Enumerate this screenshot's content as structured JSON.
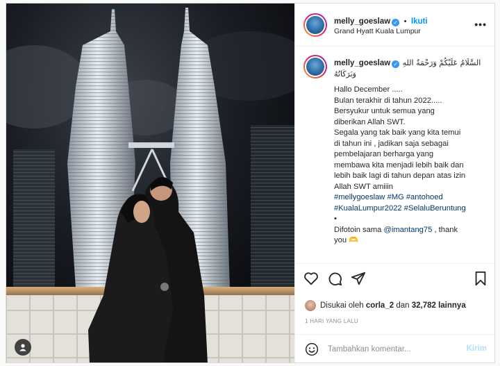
{
  "header": {
    "username": "melly_goeslaw",
    "follow_separator": "•",
    "follow_label": "Ikuti",
    "location": "Grand Hyatt Kuala Lumpur",
    "more_icon": "more-options-icon"
  },
  "caption": {
    "username": "melly_goeslaw",
    "arabic_greeting_1": "السَّلَامُ عَلَيْكُمْ وَرَحْمَةُ اللهِ",
    "arabic_greeting_2": "وَبَرَكَاتُهُ",
    "lines": [
      "Hallo December .....",
      "Bulan terakhir di tahun 2022.....",
      "Bersyukur untuk semua yang",
      "diberikan Allah SWT.",
      "Segala yang tak baik yang kita temui",
      "di tahun ini , jadikan saja sebagai",
      "pembelajaran berharga yang",
      "membawa kita menjadi lebih baik dan",
      "lebih baik lagi di tahun depan atas izin",
      "Allah SWT amiiin"
    ],
    "hashtags_1": "#mellygoeslaw #MG #antohoed",
    "hashtags_2": "#KualaLumpur2022 #SelaluBeruntung",
    "bullet": "•",
    "credit_prefix": "Difotoin sama ",
    "credit_mention": "@imantang75",
    "credit_suffix": " , thank",
    "credit_line2": "you 🫶"
  },
  "actions": {
    "like_icon": "heart-icon",
    "comment_icon": "comment-icon",
    "share_icon": "share-icon",
    "save_icon": "bookmark-icon"
  },
  "likes": {
    "prefix": "Disukai oleh ",
    "user": "corla_2",
    "middle": " dan ",
    "count": "32,782",
    "suffix": " lainnya"
  },
  "date": "1 HARI YANG LALU",
  "comment": {
    "placeholder": "Tambahkan komentar...",
    "post_label": "Kirim"
  },
  "colors": {
    "accent": "#0095f6",
    "post_disabled": "#b2dffc",
    "text": "#262626",
    "muted": "#8e8e8e",
    "hashtag": "#00376b"
  }
}
